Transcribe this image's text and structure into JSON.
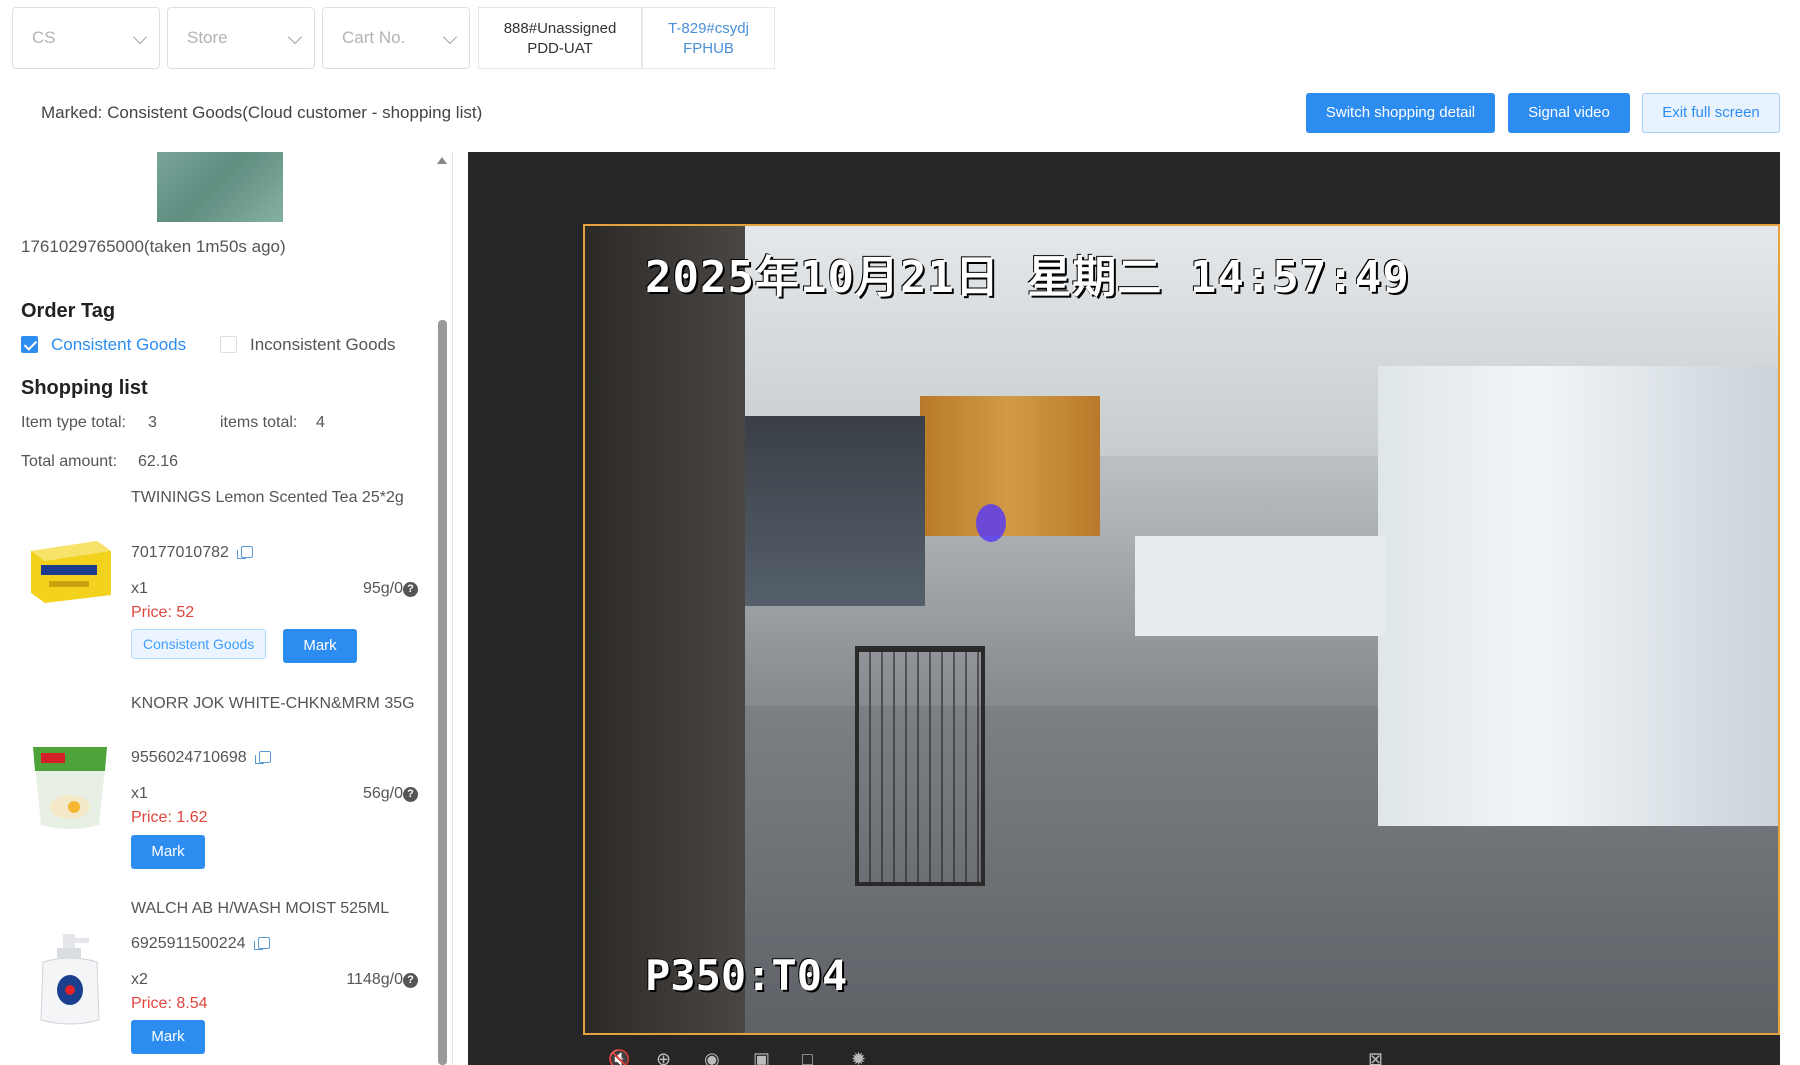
{
  "filters": {
    "cs_placeholder": "CS",
    "store_placeholder": "Store",
    "cart_placeholder": "Cart No."
  },
  "tabs": [
    {
      "line1": "888#Unassigned",
      "line2": "PDD-UAT",
      "active": false
    },
    {
      "line1": "T-829#csydj",
      "line2": "FPHUB",
      "active": true
    }
  ],
  "marked_text": "Marked: Consistent Goods(Cloud customer - shopping list)",
  "actions": {
    "switch_detail": "Switch shopping detail",
    "signal_video": "Signal video",
    "exit_fullscreen": "Exit full screen"
  },
  "snapshot": {
    "timestamp": "1761029765000(taken 1m50s ago)"
  },
  "order_tag": {
    "title": "Order Tag",
    "options": [
      {
        "label": "Consistent Goods",
        "checked": true
      },
      {
        "label": "Inconsistent Goods",
        "checked": false
      }
    ]
  },
  "shopping_list": {
    "title": "Shopping list",
    "item_type_label": "Item type total:",
    "item_type_value": "3",
    "items_total_label": "items total:",
    "items_total_value": "4",
    "total_amount_label": "Total amount:",
    "total_amount_value": "62.16",
    "items": [
      {
        "name": "TWININGS Lemon Scented Tea 25*2g",
        "code": "70177010782",
        "qty": "x1",
        "weight": "95g/0",
        "price": "Price: 52",
        "tag": "Consistent Goods",
        "mark": "Mark"
      },
      {
        "name": "KNORR JOK WHITE-CHKN&MRM 35G",
        "code": "9556024710698",
        "qty": "x1",
        "weight": "56g/0",
        "price": "Price: 1.62",
        "tag": "",
        "mark": "Mark"
      },
      {
        "name": "WALCH AB H/WASH MOIST 525ML",
        "code": "6925911500224",
        "qty": "x2",
        "weight": "1148g/0",
        "price": "Price: 8.54",
        "tag": "",
        "mark": "Mark"
      }
    ]
  },
  "video": {
    "osd_datetime": "2025年10月21日 星期二 14:57:49",
    "osd_camera": "P350:T04",
    "controls": [
      "mute-icon",
      "zoom-in-icon",
      "snapshot-icon",
      "record-icon",
      "fullscreen-focus-icon",
      "settings-icon",
      "close-icon"
    ]
  },
  "colors": {
    "primary": "#2d8cf0",
    "price": "#e0443e",
    "frame_border": "#e6a23c"
  }
}
